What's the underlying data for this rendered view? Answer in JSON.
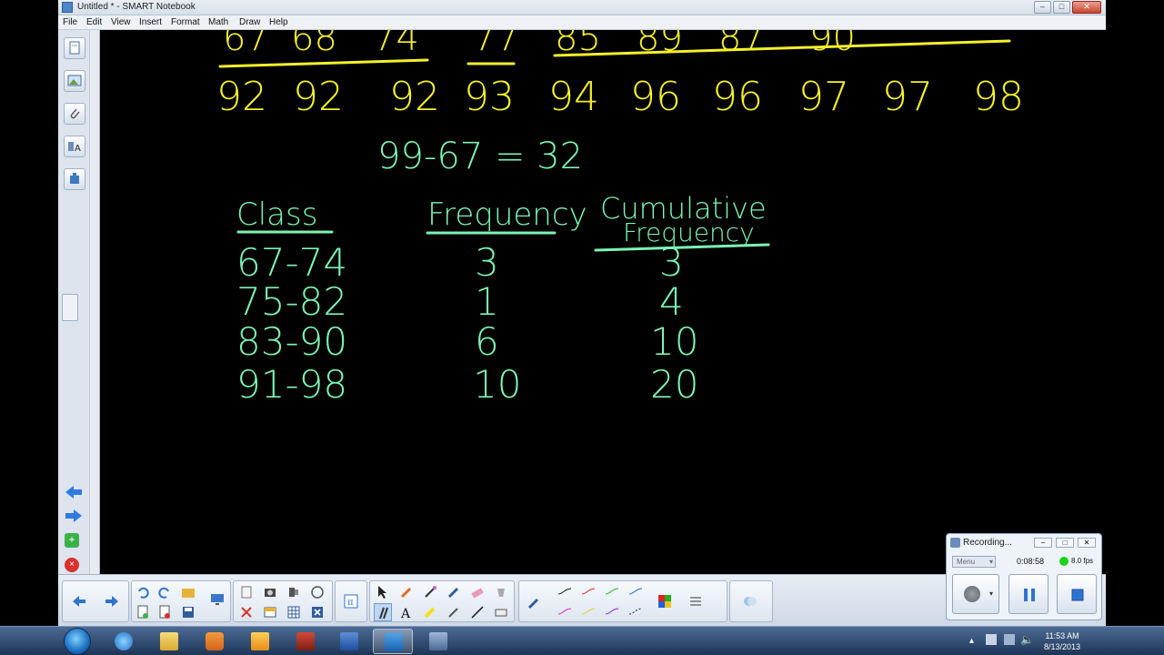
{
  "window": {
    "title": "Untitled * - SMART Notebook",
    "minimize": "–",
    "maximize": "□",
    "close": "✕"
  },
  "menu": [
    "File",
    "Edit",
    "View",
    "Insert",
    "Format",
    "Math",
    "Draw",
    "Help"
  ],
  "board": {
    "sorted_row_top_partial": [
      "67",
      "68",
      "74",
      "77",
      "85",
      "89",
      "87",
      "90"
    ],
    "sorted_row": [
      "92",
      "92",
      "92",
      "93",
      "94",
      "96",
      "96",
      "97",
      "97",
      "98"
    ],
    "range_expr": "99-67 = 32",
    "headers": {
      "class": "Class",
      "frequency": "Frequency",
      "cumulative_line1": "Cumulative",
      "cumulative_line2": "Frequency"
    },
    "rows": [
      {
        "class": "67-74",
        "freq": "3",
        "cum": "3"
      },
      {
        "class": "75-82",
        "freq": "1",
        "cum": "4"
      },
      {
        "class": "83-90",
        "freq": "6",
        "cum": "10"
      },
      {
        "class": "91-98",
        "freq": "10",
        "cum": "20"
      }
    ],
    "colors": {
      "yellow_ink": "#f4f02a",
      "green_ink": "#7cf5b4",
      "canvas_bg": "#000000"
    }
  },
  "sidetabs": [
    "page-sorter-icon",
    "gallery-icon",
    "attachments-icon",
    "properties-icon",
    "addons-icon"
  ],
  "recorder": {
    "title": "Recording...",
    "menu_label": "Menu",
    "elapsed": "0:08:58",
    "fps": "8.0 fps",
    "status_color": "#19d219"
  },
  "taskbar": {
    "time": "11:53 AM",
    "date": "8/13/2013"
  }
}
